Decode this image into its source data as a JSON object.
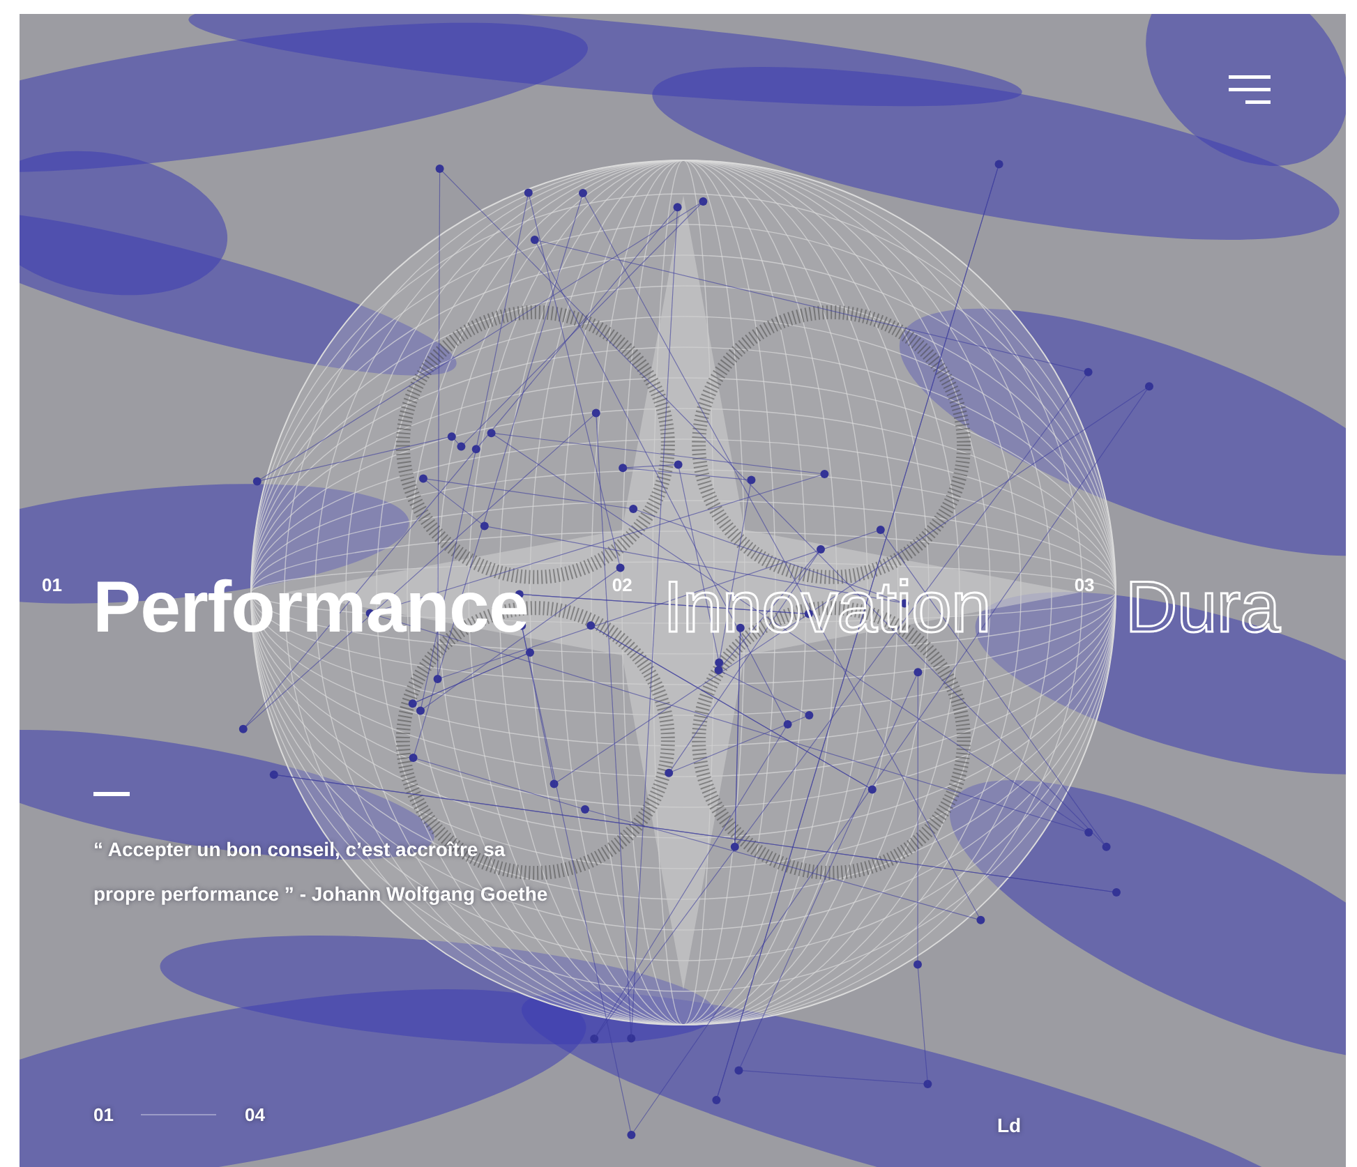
{
  "slides": [
    {
      "number": "01",
      "title": "Performance",
      "selected": true
    },
    {
      "number": "02",
      "title": "Innovation",
      "selected": false
    },
    {
      "number": "03",
      "title": "Dura",
      "selected": false
    }
  ],
  "quote": "“ Accepter un bon conseil, c’est accroître sa propre performance ” - Johann Wolfgang Goethe",
  "pager": {
    "current": "01",
    "total": "04"
  },
  "footer_label": "Ld"
}
